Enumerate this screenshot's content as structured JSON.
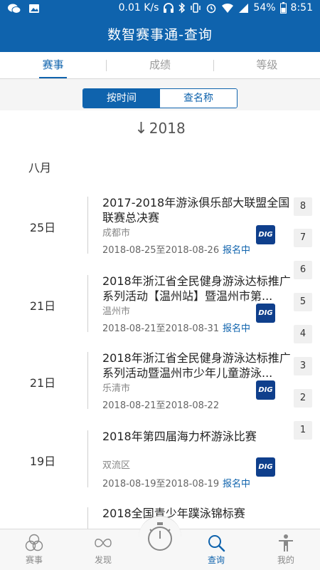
{
  "status_bar": {
    "network_speed": "0.01 K/s",
    "battery": "54%",
    "time": "8:51",
    "left_icons": [
      "wechat-icon",
      "image-icon"
    ],
    "right_icons": [
      "headphones-icon",
      "bluetooth-icon",
      "vibrate-icon",
      "alarm-icon",
      "wifi-icon",
      "signal-icon",
      "battery-icon"
    ]
  },
  "header": {
    "title": "数智赛事通-查询"
  },
  "tabs": [
    {
      "label": "赛事",
      "active": true
    },
    {
      "label": "成绩",
      "active": false
    },
    {
      "label": "等级",
      "active": false
    }
  ],
  "segment": {
    "by_time": "按时间",
    "by_name": "查名称"
  },
  "year": "2018",
  "month": "八月",
  "events": [
    {
      "day": "25日",
      "title": "2017-2018年游泳俱乐部大联盟全国联赛总决赛",
      "location": "成都市",
      "dates": "2018-08-25至2018-08-26",
      "status": "报名中",
      "logo": "DIG"
    },
    {
      "day": "21日",
      "title": "2018年浙江省全民健身游泳达标推广系列活动【温州站】暨温州市第...",
      "location": "温州市",
      "dates": "2018-08-21至2018-08-31",
      "status": "报名中",
      "logo": "DIG"
    },
    {
      "day": "21日",
      "title": "2018年浙江省全民健身游泳达标推广系列活动暨温州市少年儿童游泳...",
      "location": "乐清市",
      "dates": "2018-08-21至2018-08-22",
      "status": "",
      "logo": "DIG"
    },
    {
      "day": "19日",
      "title": "2018年第四届海力杯游泳比赛",
      "location": "双流区",
      "dates": "2018-08-19至2018-08-19",
      "status": "报名中",
      "logo": "DIG"
    },
    {
      "day": "",
      "title": "2018全国青少年蹼泳锦标赛",
      "location": "",
      "dates": "",
      "status": "",
      "logo": ""
    }
  ],
  "month_index": [
    "8",
    "7",
    "6",
    "5",
    "4",
    "3",
    "2",
    "1"
  ],
  "bottom_nav": [
    {
      "label": "赛事",
      "icon": "circles-icon",
      "active": false
    },
    {
      "label": "发现",
      "icon": "infinity-icon",
      "active": false
    },
    {
      "label": "",
      "icon": "stopwatch-icon",
      "active": false
    },
    {
      "label": "查询",
      "icon": "search-icon",
      "active": true
    },
    {
      "label": "我的",
      "icon": "person-icon",
      "active": false
    }
  ],
  "colors": {
    "primary": "#0f63ad",
    "logo": "#0f3f8c"
  }
}
